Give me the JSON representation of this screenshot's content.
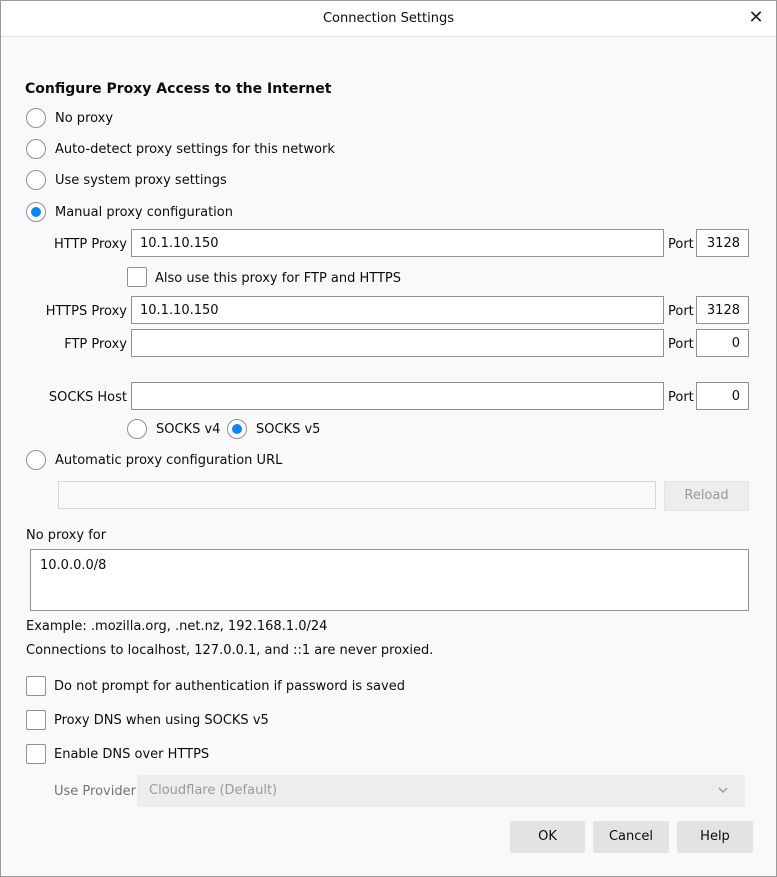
{
  "window": {
    "title": "Connection Settings",
    "close_glyph": "✕"
  },
  "heading": "Configure Proxy Access to the Internet",
  "proxy_options": {
    "no_proxy": "No proxy",
    "auto_detect": "Auto-detect proxy settings for this network",
    "use_system": "Use system proxy settings",
    "manual": "Manual proxy configuration",
    "auto_url": "Automatic proxy configuration URL",
    "selected": "manual"
  },
  "manual": {
    "http_label": "HTTP Proxy",
    "http_value": "10.1.10.150",
    "http_port": "3128",
    "also_use_label": "Also use this proxy for FTP and HTTPS",
    "https_label": "HTTPS Proxy",
    "https_value": "10.1.10.150",
    "https_port": "3128",
    "ftp_label": "FTP Proxy",
    "ftp_value": "",
    "ftp_port": "0",
    "socks_label": "SOCKS Host",
    "socks_value": "",
    "socks_port": "0",
    "port_label": "Port",
    "socks_v4": "SOCKS v4",
    "socks_v5": "SOCKS v5",
    "socks_selected": "v5"
  },
  "auto_url": {
    "value": "",
    "reload_label": "Reload"
  },
  "no_proxy_for": {
    "label": "No proxy for",
    "value": "10.0.0.0/8",
    "example": "Example: .mozilla.org, .net.nz, 192.168.1.0/24",
    "note": "Connections to localhost, 127.0.0.1, and ::1 are never proxied."
  },
  "checks": {
    "no_prompt_auth": "Do not prompt for authentication if password is saved",
    "proxy_dns": "Proxy DNS when using SOCKS v5",
    "enable_doh": "Enable DNS over HTTPS"
  },
  "provider": {
    "label": "Use Provider",
    "value": "Cloudflare (Default)"
  },
  "buttons": {
    "ok": "OK",
    "cancel": "Cancel",
    "help": "Help"
  },
  "colors": {
    "accent": "#0a84ff",
    "button_bg": "#e3e3e5"
  }
}
